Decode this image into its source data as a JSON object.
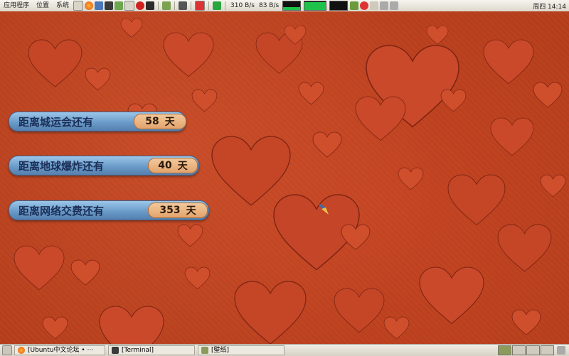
{
  "top_panel": {
    "menus": [
      "应用程序",
      "位置",
      "系统"
    ],
    "net_down": "310 B/s",
    "net_up": "83 B/s",
    "clock": "周四 14:14"
  },
  "countdowns": [
    {
      "label": "距离城运会还有",
      "value": "58",
      "unit": "天"
    },
    {
      "label": "距离地球爆炸还有",
      "value": "40",
      "unit": "天"
    },
    {
      "label": "距离网络交费还有",
      "value": "353",
      "unit": "天"
    }
  ],
  "taskbar": {
    "items": [
      {
        "label": "[Ubuntu中文论坛 • ···"
      },
      {
        "label": "[Terminal]"
      },
      {
        "label": "[壁纸]"
      }
    ]
  },
  "colors": {
    "wallpaper": "#b8401d",
    "heart": "#c9492a",
    "widget_blue": "#6a9bc9",
    "widget_pill": "#e3a36c"
  }
}
